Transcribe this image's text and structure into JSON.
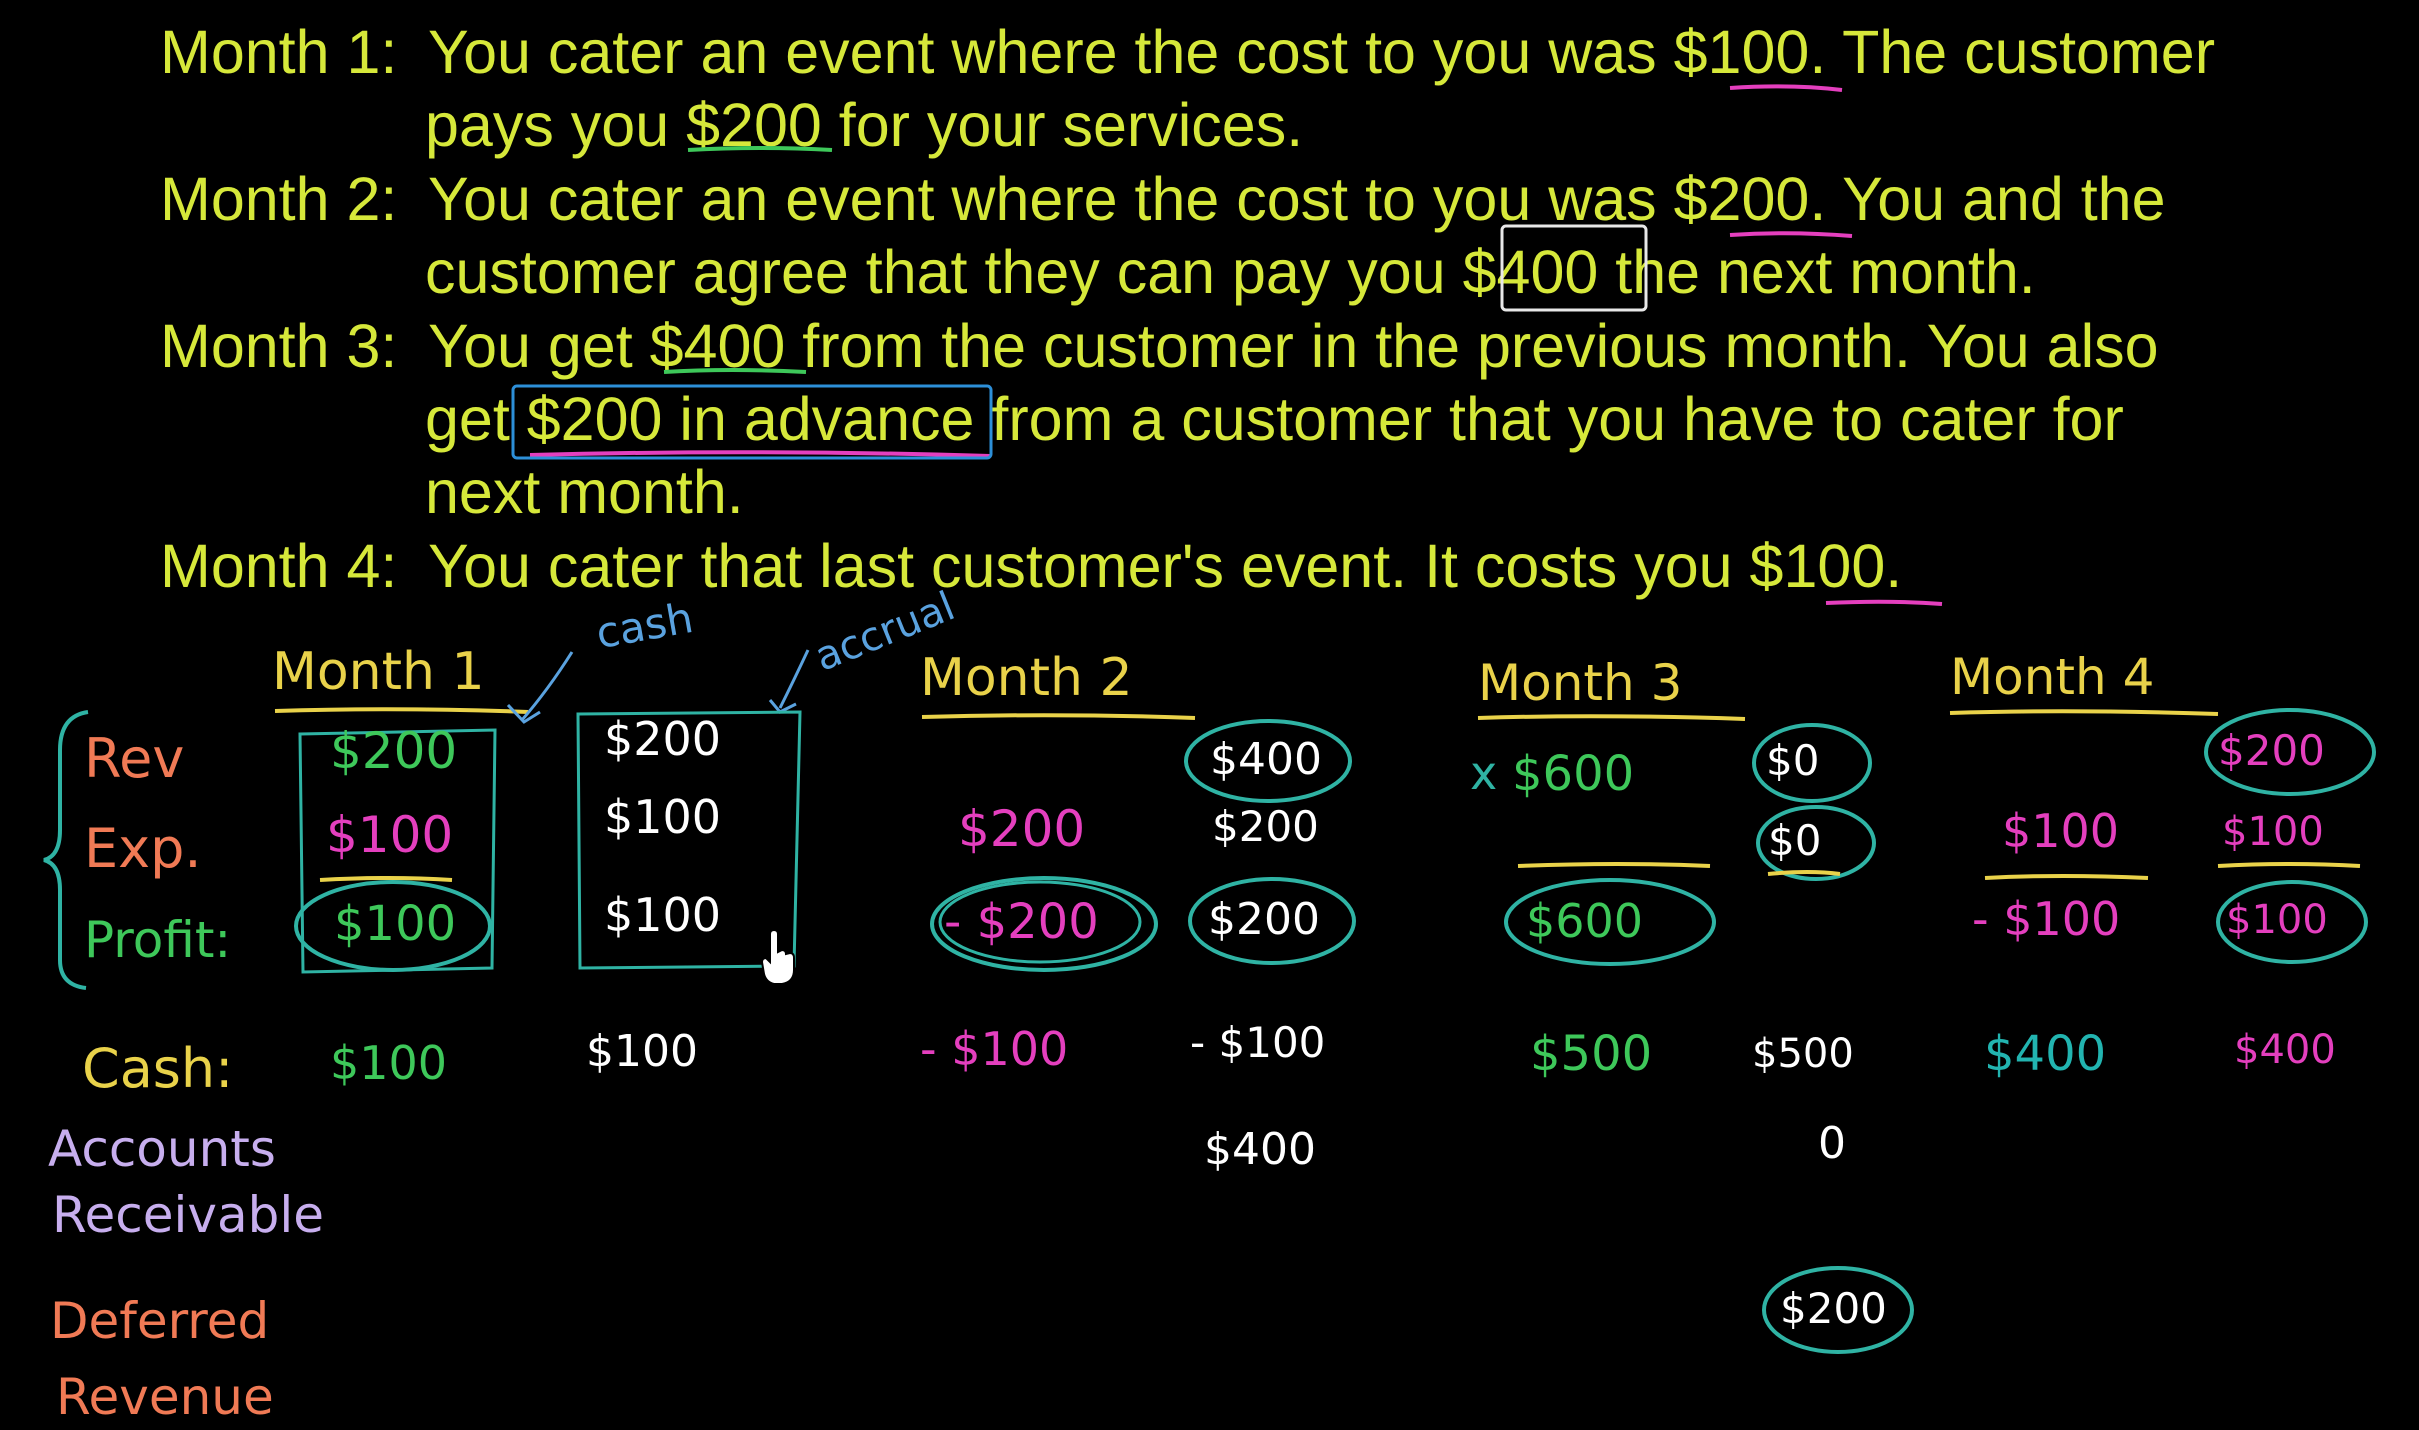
{
  "problem": {
    "lines": [
      {
        "label": "Month 1:",
        "text": "You cater an event where the cost to you was $100.  The customer"
      },
      {
        "text": "pays you $200 for your services."
      },
      {
        "label": "Month 2:",
        "text": "You cater an event where the cost to you was $200.  You and the"
      },
      {
        "text": "customer agree that they can pay you $400 the next month."
      },
      {
        "label": "Month 3:",
        "text": "You get $400 from the customer in the previous month.  You also"
      },
      {
        "text": "get $200 in advance from a customer that you have to cater for"
      },
      {
        "text": "next month."
      },
      {
        "label": "Month 4:",
        "text": "You cater that last customer's event.  It costs you $100."
      }
    ]
  },
  "methods": {
    "cash": "cash",
    "accrual": "accrual"
  },
  "row_labels": {
    "rev": "Rev",
    "exp": "Exp.",
    "profit": "Profit:",
    "cash": "Cash:",
    "ar_line1": "Accounts",
    "ar_line2": "Receivable",
    "dr_line1": "Deferred",
    "dr_line2": "Revenue"
  },
  "months": [
    {
      "header": "Month 1",
      "cash_basis": {
        "rev": "$200",
        "exp": "$100",
        "profit": "$100",
        "cash": "$100"
      },
      "accrual_basis": {
        "rev": "$200",
        "exp": "$100",
        "profit": "$100",
        "cash": "$100"
      }
    },
    {
      "header": "Month 2",
      "cash_basis": {
        "rev": "",
        "exp": "$200",
        "profit": "- $200",
        "cash": "- $100"
      },
      "accrual_basis": {
        "rev": "$400",
        "exp": "$200",
        "profit": "$200",
        "cash": "- $100",
        "accounts_receivable": "$400"
      }
    },
    {
      "header": "Month 3",
      "cash_basis": {
        "rev": "$600",
        "rev_mark": "x",
        "exp": "",
        "profit": "$600",
        "cash": "$500"
      },
      "accrual_basis": {
        "rev": "$0",
        "exp": "$0",
        "cash": "$500",
        "accounts_receivable": "0",
        "deferred_revenue": "$200"
      }
    },
    {
      "header": "Month 4",
      "cash_basis": {
        "rev": "",
        "exp": "$100",
        "profit": "- $100",
        "cash": "$400"
      },
      "accrual_basis": {
        "rev": "$200",
        "exp": "$100",
        "profit": "$100",
        "cash": "$400"
      }
    }
  ]
}
